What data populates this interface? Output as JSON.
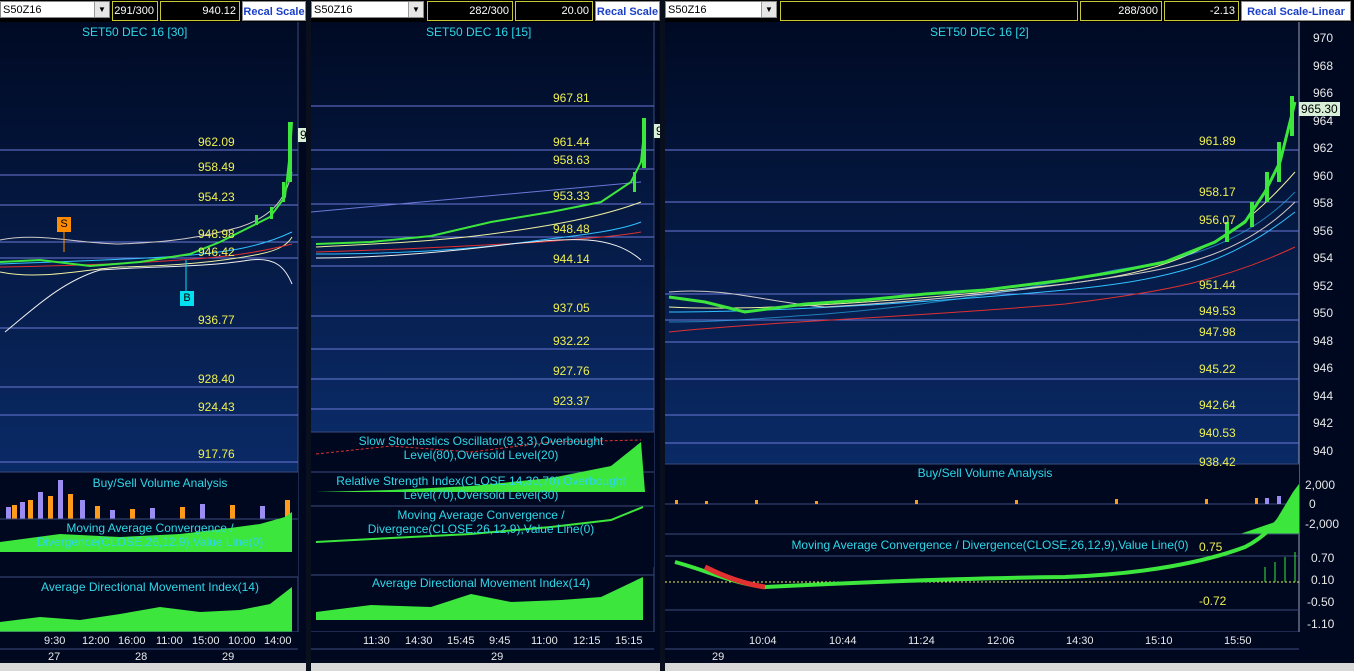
{
  "panel1": {
    "symbol": "S50Z16",
    "bars": "291/300",
    "value": "940.12",
    "recal_label": "Recal Scale",
    "title": "SET50 DEC 16  [30]",
    "levels": [
      "962.09",
      "958.49",
      "954.23",
      "948.98",
      "946.42",
      "936.77",
      "928.40",
      "924.43",
      "917.76"
    ],
    "sell_marker": "S",
    "buy_marker": "B",
    "price_edge": "9",
    "ind1": "Buy/Sell Volume Analysis",
    "ind2": "Moving Average Convergence / Divergence(CLOSE,26,12,9),Value Line(0)",
    "ind3": "Average Directional Movement Index(14)",
    "times": [
      "9:30",
      "12:00",
      "16:00",
      "11:00",
      "15:00",
      "10:00",
      "14:00"
    ],
    "dates": [
      "27",
      "28",
      "29"
    ]
  },
  "panel2": {
    "symbol": "S50Z16",
    "bars": "282/300",
    "value": "20.00",
    "recal_label": "Recal Scale",
    "title": "SET50 DEC 16  [15]",
    "levels": [
      "967.81",
      "961.44",
      "958.63",
      "953.33",
      "948.48",
      "944.14",
      "937.05",
      "932.22",
      "927.76",
      "923.37"
    ],
    "price_edge": "9",
    "ind1": "Slow Stochastics Oscillator(9,3,3),Overbought Level(80),Oversold Level(20)",
    "ind2": "Relative Strength Index(CLOSE,14,30,70),Overbought Level(70),Oversold Level(30)",
    "ind3": "Moving Average Convergence / Divergence(CLOSE,26,12,9),Value Line(0)",
    "ind4": "Average Directional Movement Index(14)",
    "times": [
      "11:30",
      "14:30",
      "15:45",
      "9:45",
      "11:00",
      "12:15",
      "15:15"
    ],
    "dates": [
      "29"
    ]
  },
  "panel3": {
    "symbol": "S50Z16",
    "bars": "288/300",
    "value": "-2.13",
    "recal_label": "Recal Scale-Linear",
    "title": "SET50 DEC 16  [2]",
    "levels": [
      "961.89",
      "958.17",
      "956.07",
      "951.44",
      "949.53",
      "947.98",
      "945.22",
      "942.64",
      "940.53",
      "938.42"
    ],
    "price_tag": "965.30",
    "y_axis": [
      "970",
      "968",
      "966",
      "964",
      "962",
      "960",
      "958",
      "956",
      "954",
      "952",
      "950",
      "948",
      "946",
      "944",
      "942",
      "940"
    ],
    "vol_title": "Buy/Sell Volume Analysis",
    "vol_axis": [
      "2,000",
      "0",
      "-2,000"
    ],
    "macd_title": "Moving Average Convergence / Divergence(CLOSE,26,12,9),Value Line(0)",
    "macd_levels": [
      "0.75",
      "-0.72"
    ],
    "macd_axis": [
      "0.70",
      "0.10",
      "-0.50",
      "-1.10"
    ],
    "times": [
      "10:04",
      "10:44",
      "11:24",
      "12:06",
      "14:30",
      "15:10",
      "15:50"
    ],
    "dates": [
      "29"
    ]
  },
  "colors": {
    "accent_cyan": "#2fd7e8",
    "level_yellow": "#f0f050",
    "candle_green": "#3ce63c",
    "recal_blue": "#1a3ec8"
  }
}
